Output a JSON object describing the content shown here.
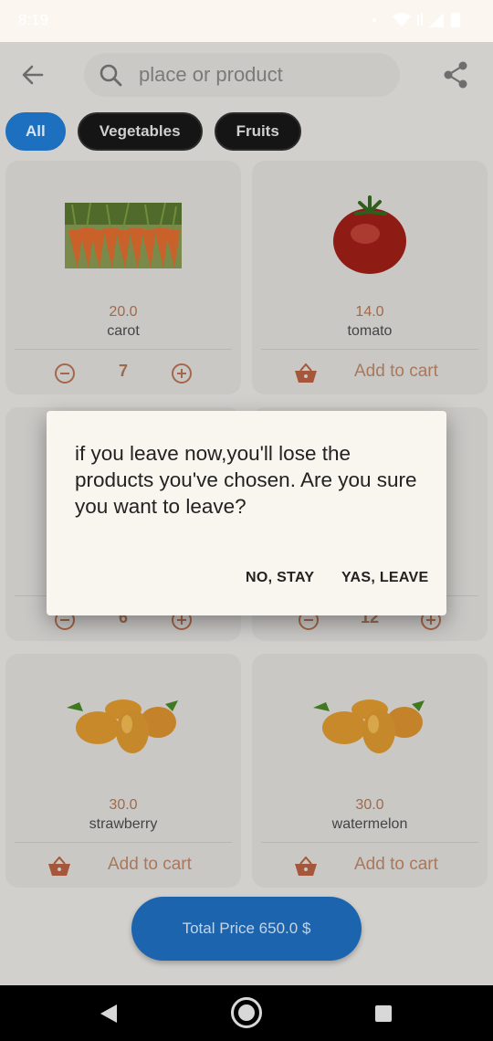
{
  "status": {
    "time": "8:19"
  },
  "search": {
    "placeholder": "place or product"
  },
  "filters": [
    "All",
    "Vegetables",
    "Fruits"
  ],
  "products": [
    {
      "price": "20.0",
      "name": "carot",
      "quantity": "7"
    },
    {
      "price": "14.0",
      "name": "tomato",
      "action_label": "Add to cart"
    },
    {
      "quantity": "6"
    },
    {
      "quantity": "12"
    },
    {
      "price": "30.0",
      "name": "strawberry",
      "action_label": "Add to cart"
    },
    {
      "price": "30.0",
      "name": "watermelon",
      "action_label": "Add to cart"
    }
  ],
  "total_label": "Total Price 650.0 $",
  "dialog": {
    "message": "if you leave now,you'll lose the products you've chosen. Are you sure you want to leave?",
    "stay_label": "NO, STAY",
    "leave_label": "YAS, LEAVE"
  },
  "colors": {
    "accent": "#1d6fbf",
    "price": "#a1694a",
    "chip_dark": "#151515"
  }
}
